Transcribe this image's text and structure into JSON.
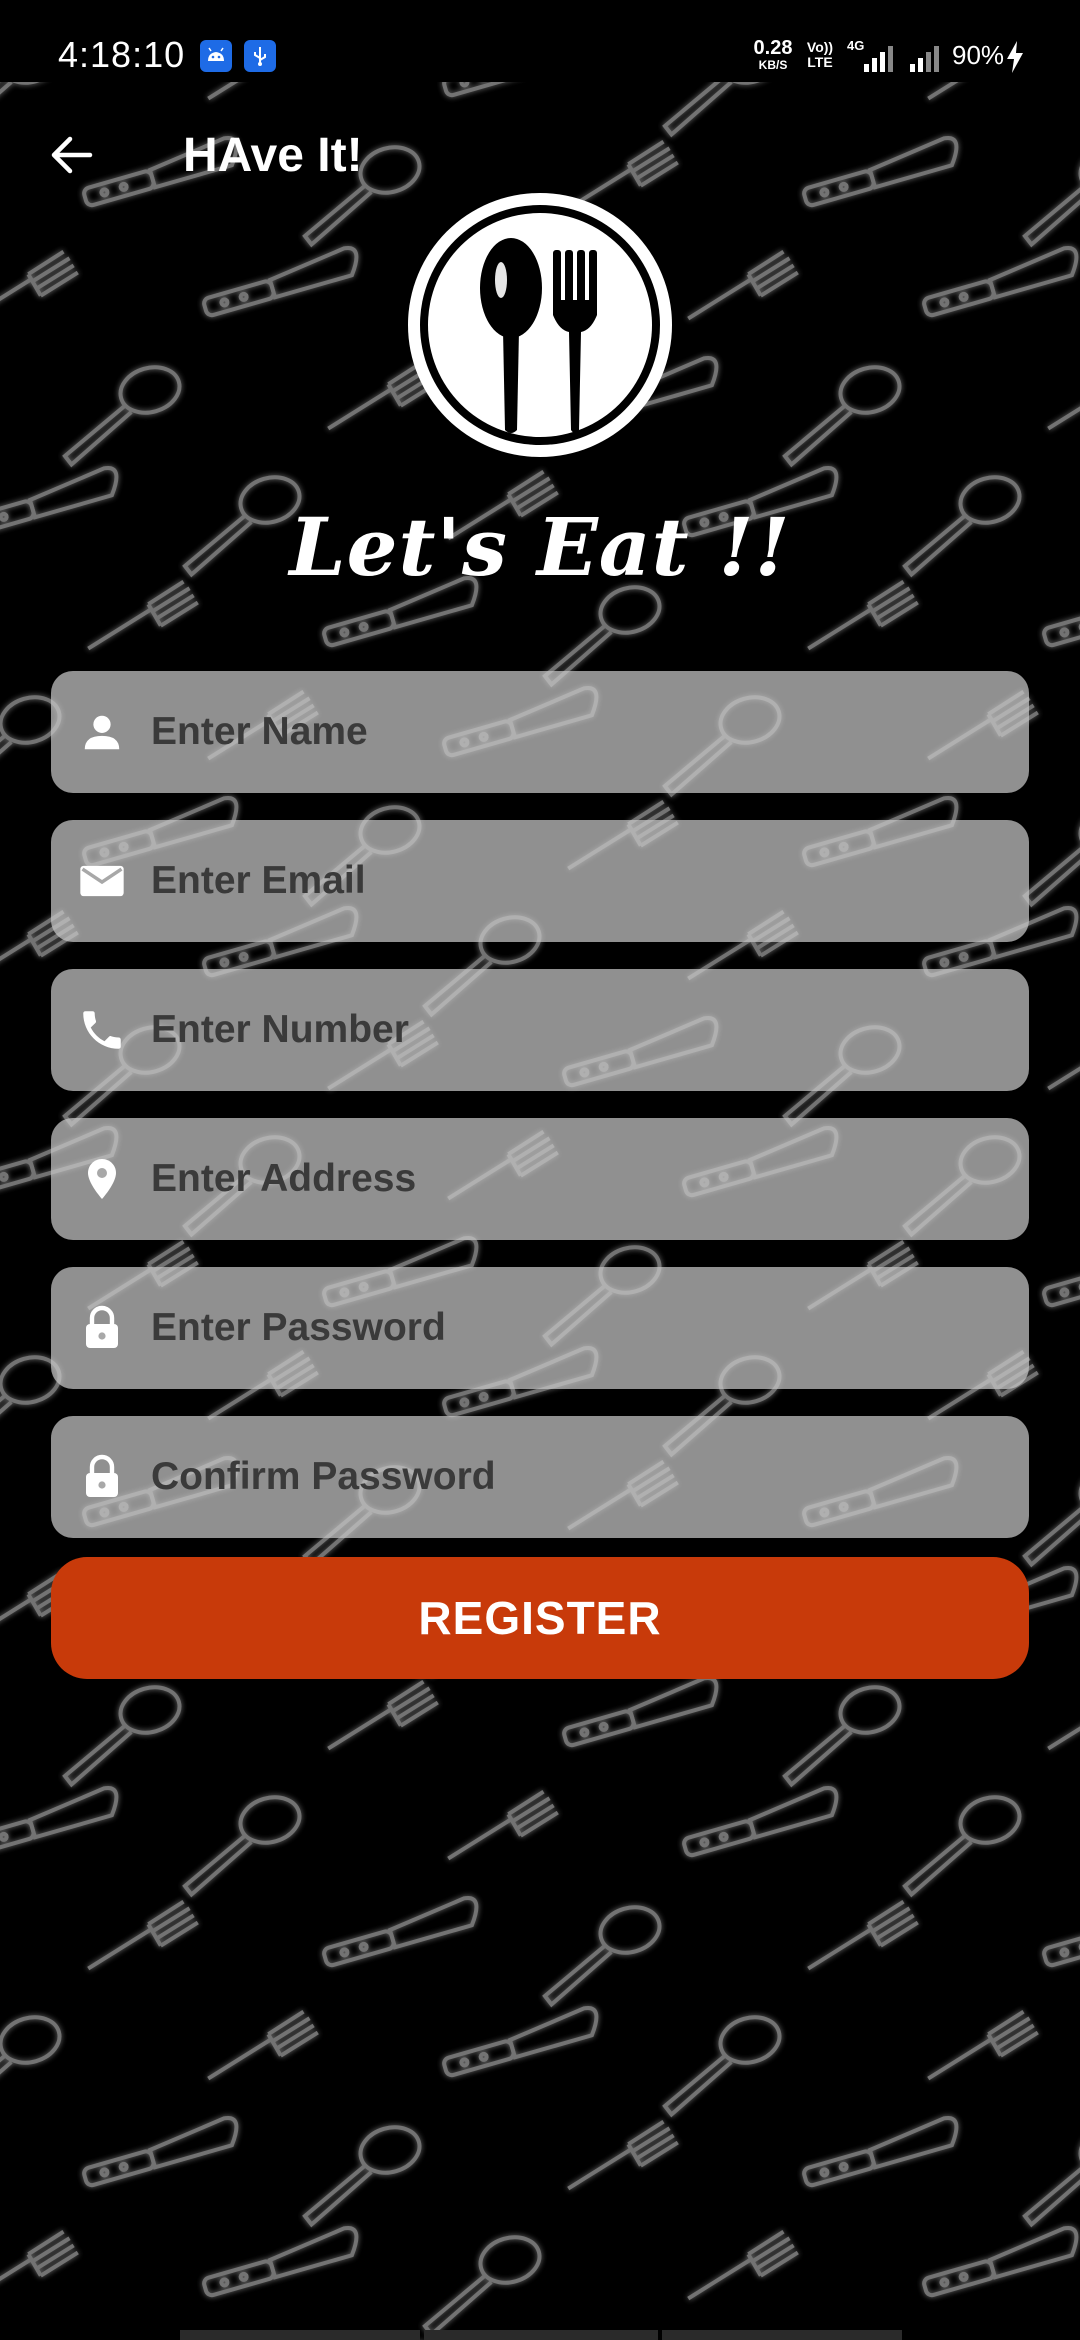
{
  "status_bar": {
    "time": "4:18:10",
    "net_speed_value": "0.28",
    "net_speed_unit": "KB/S",
    "volte_top": "Vo))",
    "volte_bottom": "LTE",
    "signal_label": "4G",
    "battery": "90%"
  },
  "app_bar": {
    "title": "HAve It!"
  },
  "hero": {
    "tagline": "Let's Eat !!"
  },
  "form": {
    "name_placeholder": "Enter Name",
    "email_placeholder": "Enter Email",
    "number_placeholder": "Enter Number",
    "address_placeholder": "Enter Address",
    "password_placeholder": "Enter Password",
    "confirm_placeholder": "Confirm Password",
    "register_label": "REGISTER"
  },
  "colors": {
    "accent": "#c83a0a",
    "field_bg": "#a8a8a8",
    "badge": "#1e6be6"
  }
}
